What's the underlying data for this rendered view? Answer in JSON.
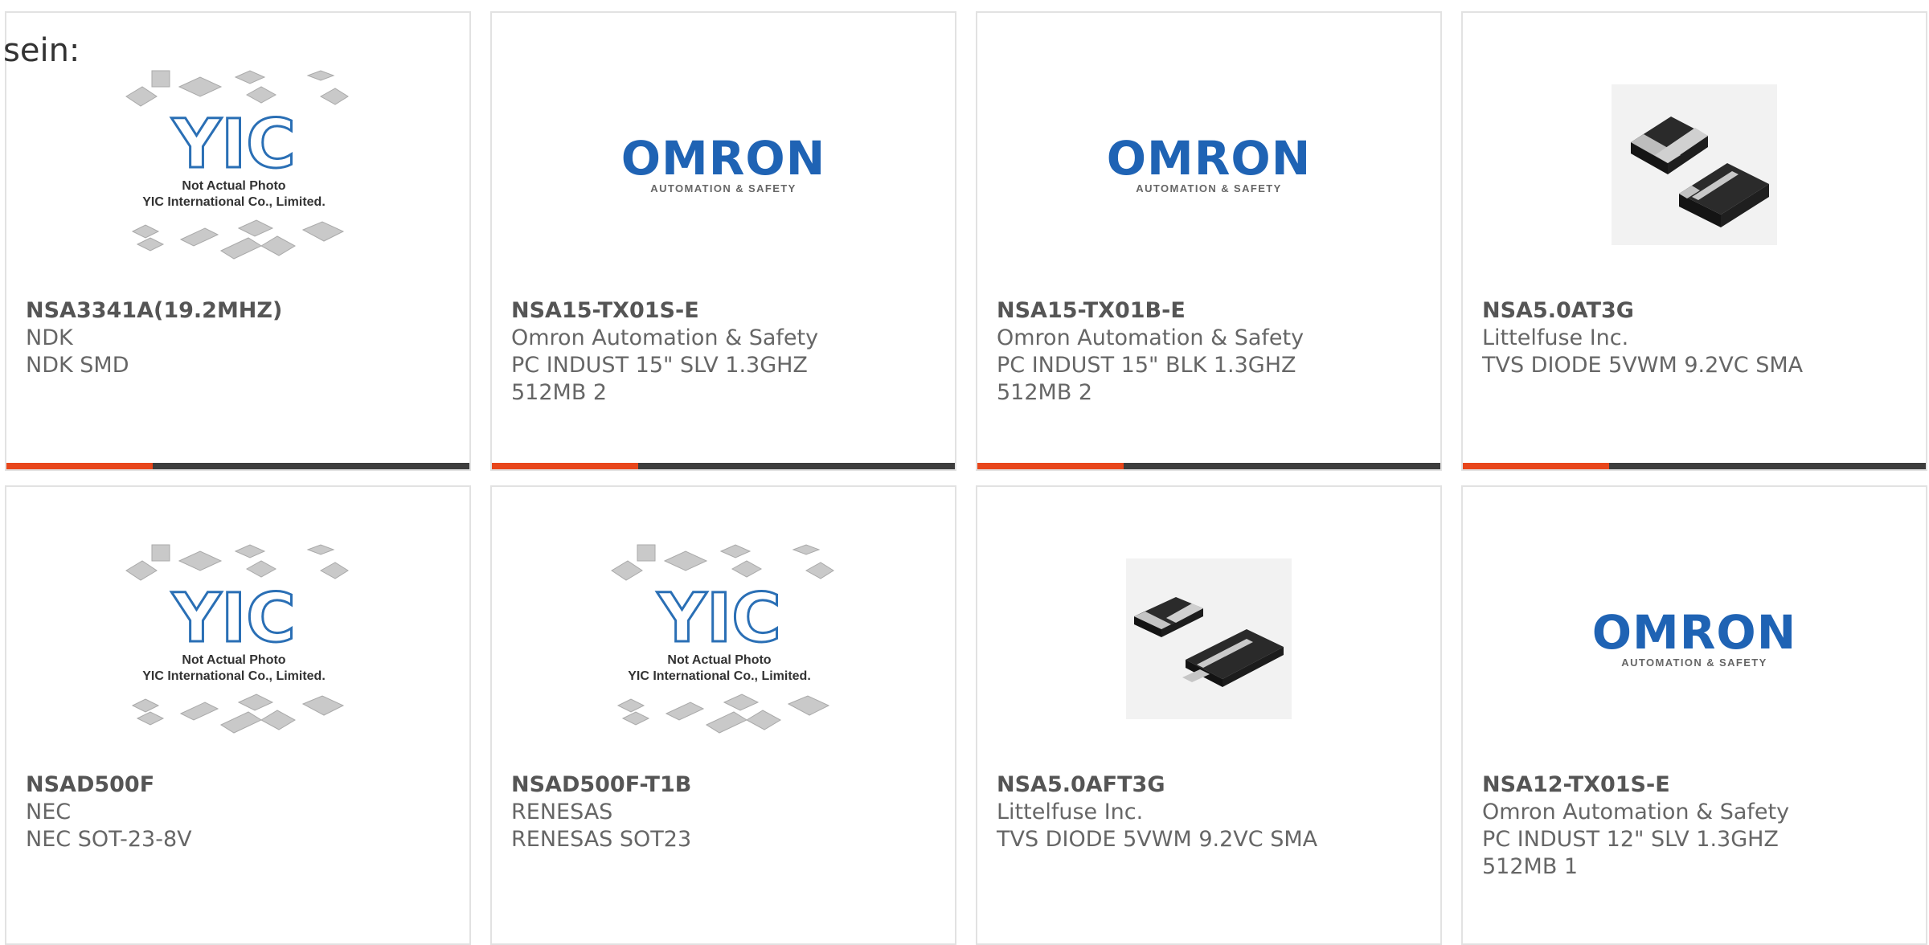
{
  "lead_text": "sein:",
  "placeholder_logo": {
    "brand": "YIC",
    "line1": "Not Actual Photo",
    "line2": "YIC International Co., Limited."
  },
  "omron_logo": {
    "word": "OMRON",
    "tagline": "AUTOMATION & SAFETY"
  },
  "colors": {
    "accent": "#e8461b",
    "bar": "#3d3d3d",
    "omron_blue": "#1f63b4",
    "yic_blue": "#2a6fb5"
  },
  "products": [
    {
      "part": "NSA3341A(19.2MHZ)",
      "maker": "NDK",
      "desc": "NDK SMD",
      "image": "yic-placeholder"
    },
    {
      "part": "NSA15-TX01S-E",
      "maker": "Omron Automation & Safety",
      "desc": "PC INDUST 15\" SLV 1.3GHZ\n512MB 2",
      "image": "omron-logo"
    },
    {
      "part": "NSA15-TX01B-E",
      "maker": "Omron Automation & Safety",
      "desc": "PC INDUST 15\" BLK 1.3GHZ\n512MB 2",
      "image": "omron-logo"
    },
    {
      "part": "NSA5.0AT3G",
      "maker": "Littelfuse Inc.",
      "desc": "TVS DIODE 5VWM 9.2VC SMA",
      "image": "sma-diode"
    },
    {
      "part": "NSAD500F",
      "maker": "NEC",
      "desc": "NEC SOT-23-8V",
      "image": "yic-placeholder"
    },
    {
      "part": "NSAD500F-T1B",
      "maker": "RENESAS",
      "desc": "RENESAS SOT23",
      "image": "yic-placeholder"
    },
    {
      "part": "NSA5.0AFT3G",
      "maker": "Littelfuse Inc.",
      "desc": "TVS DIODE 5VWM 9.2VC SMA",
      "image": "sma-flat-diode"
    },
    {
      "part": "NSA12-TX01S-E",
      "maker": "Omron Automation & Safety",
      "desc": "PC INDUST 12\" SLV 1.3GHZ\n512MB 1",
      "image": "omron-logo"
    }
  ]
}
